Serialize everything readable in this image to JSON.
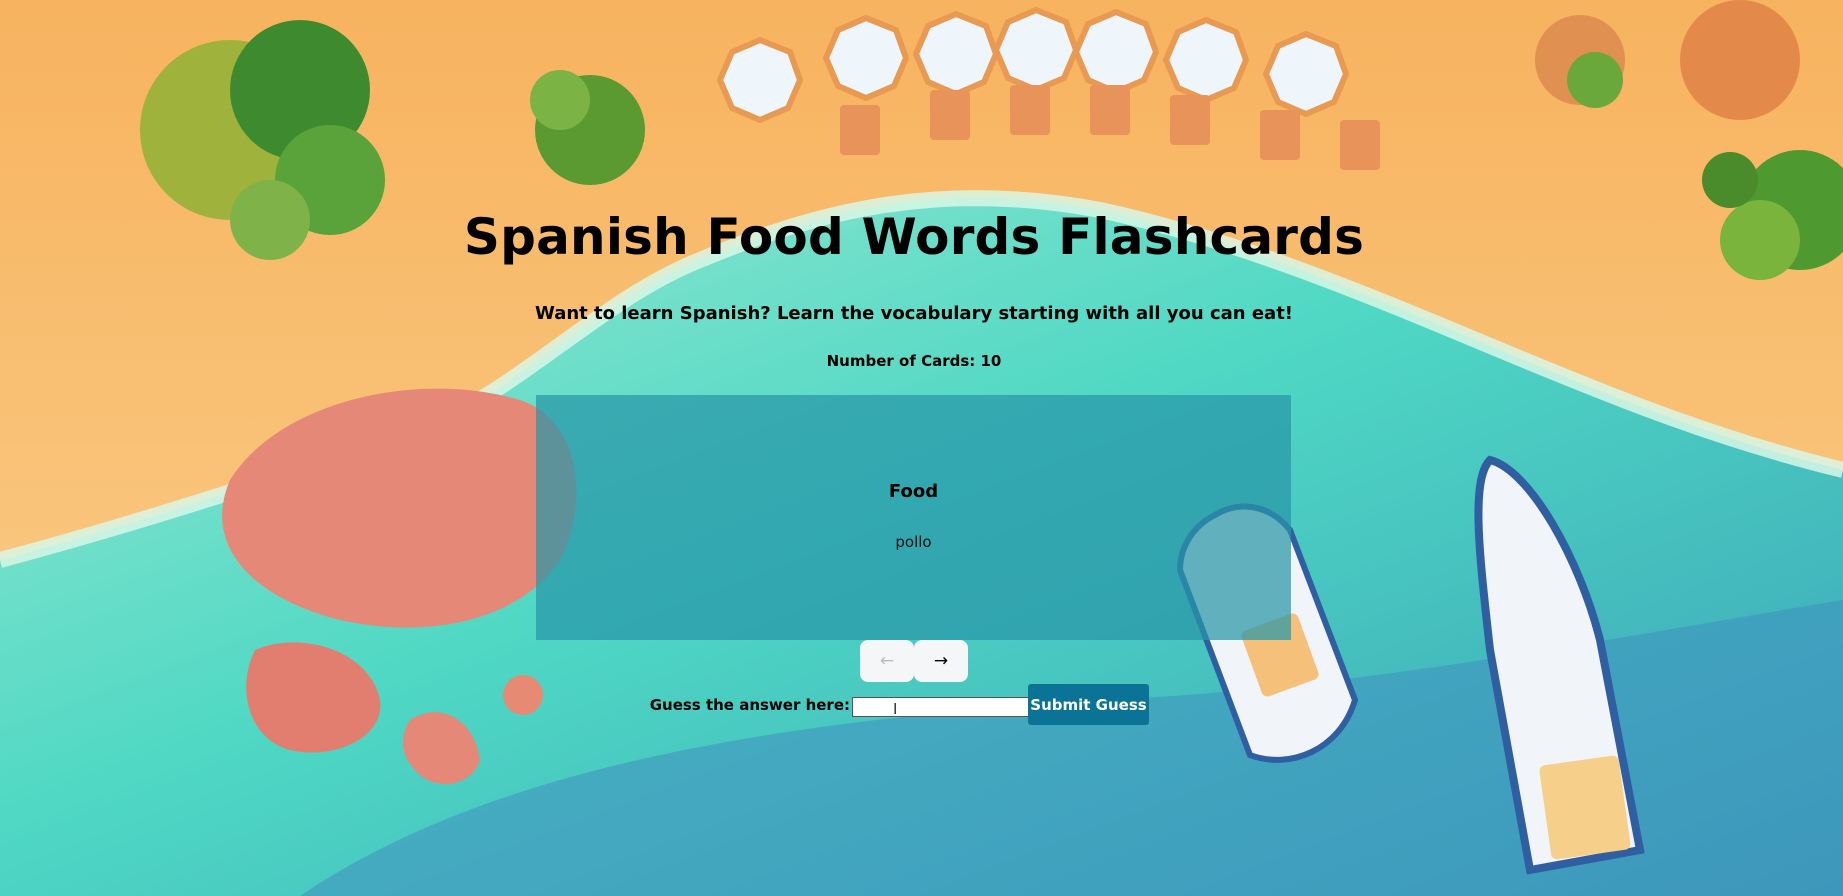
{
  "page": {
    "title": "Spanish Food Words Flashcards",
    "subtitle": "Want to learn Spanish? Learn the vocabulary starting with all you can eat!",
    "card_count_text": "Number of Cards: 10"
  },
  "flashcard": {
    "category": "Food",
    "word": "pollo"
  },
  "navigation": {
    "prev_label": "←",
    "next_label": "→"
  },
  "guess": {
    "label": "Guess the answer here:",
    "value": "",
    "submit_label": "Submit Guess"
  },
  "colors": {
    "card_background": "#2896a8",
    "submit_button": "#0b7396",
    "nav_button": "#f4f6f8",
    "sand": "#f7c27a",
    "water": "#4fd8c2"
  }
}
